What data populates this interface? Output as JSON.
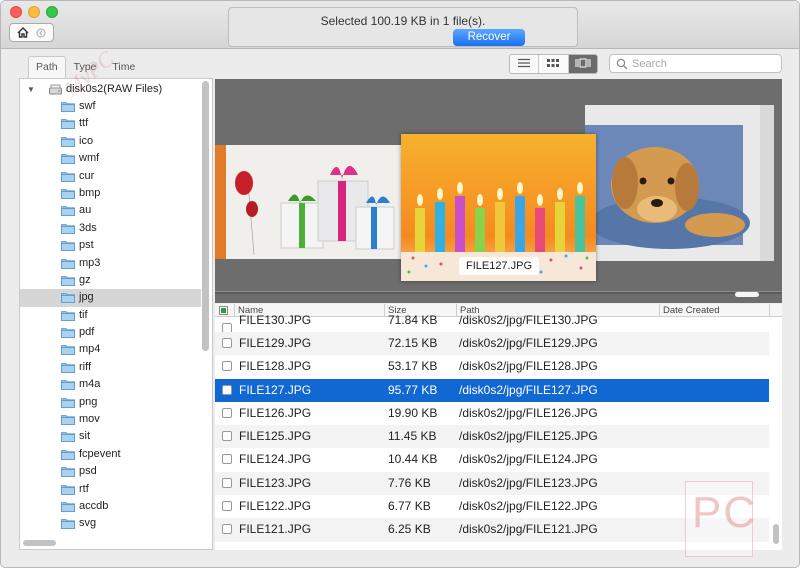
{
  "titlebar": {
    "status_text": "Selected 100.19 KB in 1 file(s).",
    "recover_label": "Recover",
    "buttons": [
      "home-icon",
      "back-icon"
    ]
  },
  "sort_tabs": [
    {
      "label": "Path",
      "active": true
    },
    {
      "label": "Type",
      "active": false
    },
    {
      "label": "Time",
      "active": false
    }
  ],
  "view_modes": [
    {
      "icon": "list-view-icon",
      "active": false
    },
    {
      "icon": "grid-view-icon",
      "active": false
    },
    {
      "icon": "coverflow-view-icon",
      "active": true
    }
  ],
  "search": {
    "placeholder": "Search",
    "value": ""
  },
  "tree": {
    "root_label": "disk0s2(RAW Files)",
    "selected": "jpg",
    "items": [
      "swf",
      "ttf",
      "ico",
      "wmf",
      "cur",
      "bmp",
      "au",
      "3ds",
      "pst",
      "mp3",
      "gz",
      "jpg",
      "tif",
      "pdf",
      "mp4",
      "riff",
      "m4a",
      "png",
      "mov",
      "sit",
      "fcpevent",
      "psd",
      "rtf",
      "accdb",
      "svg"
    ]
  },
  "preview": {
    "current_label": "FILE127.JPG"
  },
  "table": {
    "columns": [
      "Name",
      "Size",
      "Path",
      "Date Created"
    ],
    "selected_name": "FILE127.JPG",
    "rows": [
      {
        "name": "FILE130.JPG",
        "size": "71.84 KB",
        "path": "/disk0s2/jpg/FILE130.JPG"
      },
      {
        "name": "FILE129.JPG",
        "size": "72.15 KB",
        "path": "/disk0s2/jpg/FILE129.JPG"
      },
      {
        "name": "FILE128.JPG",
        "size": "53.17 KB",
        "path": "/disk0s2/jpg/FILE128.JPG"
      },
      {
        "name": "FILE127.JPG",
        "size": "95.77 KB",
        "path": "/disk0s2/jpg/FILE127.JPG"
      },
      {
        "name": "FILE126.JPG",
        "size": "19.90 KB",
        "path": "/disk0s2/jpg/FILE126.JPG"
      },
      {
        "name": "FILE125.JPG",
        "size": "11.45 KB",
        "path": "/disk0s2/jpg/FILE125.JPG"
      },
      {
        "name": "FILE124.JPG",
        "size": "10.44 KB",
        "path": "/disk0s2/jpg/FILE124.JPG"
      },
      {
        "name": "FILE123.JPG",
        "size": "7.76 KB",
        "path": "/disk0s2/jpg/FILE123.JPG"
      },
      {
        "name": "FILE122.JPG",
        "size": "6.77 KB",
        "path": "/disk0s2/jpg/FILE122.JPG"
      },
      {
        "name": "FILE121.JPG",
        "size": "6.25 KB",
        "path": "/disk0s2/jpg/FILE121.JPG"
      }
    ]
  },
  "watermark": {
    "logo_text": "PC",
    "script_text": "MyPC"
  },
  "colors": {
    "accent": "#1268d3",
    "recover": "#2b80f5",
    "close": "#fc605c",
    "minimize": "#fdbc40",
    "zoom": "#34c84a"
  }
}
